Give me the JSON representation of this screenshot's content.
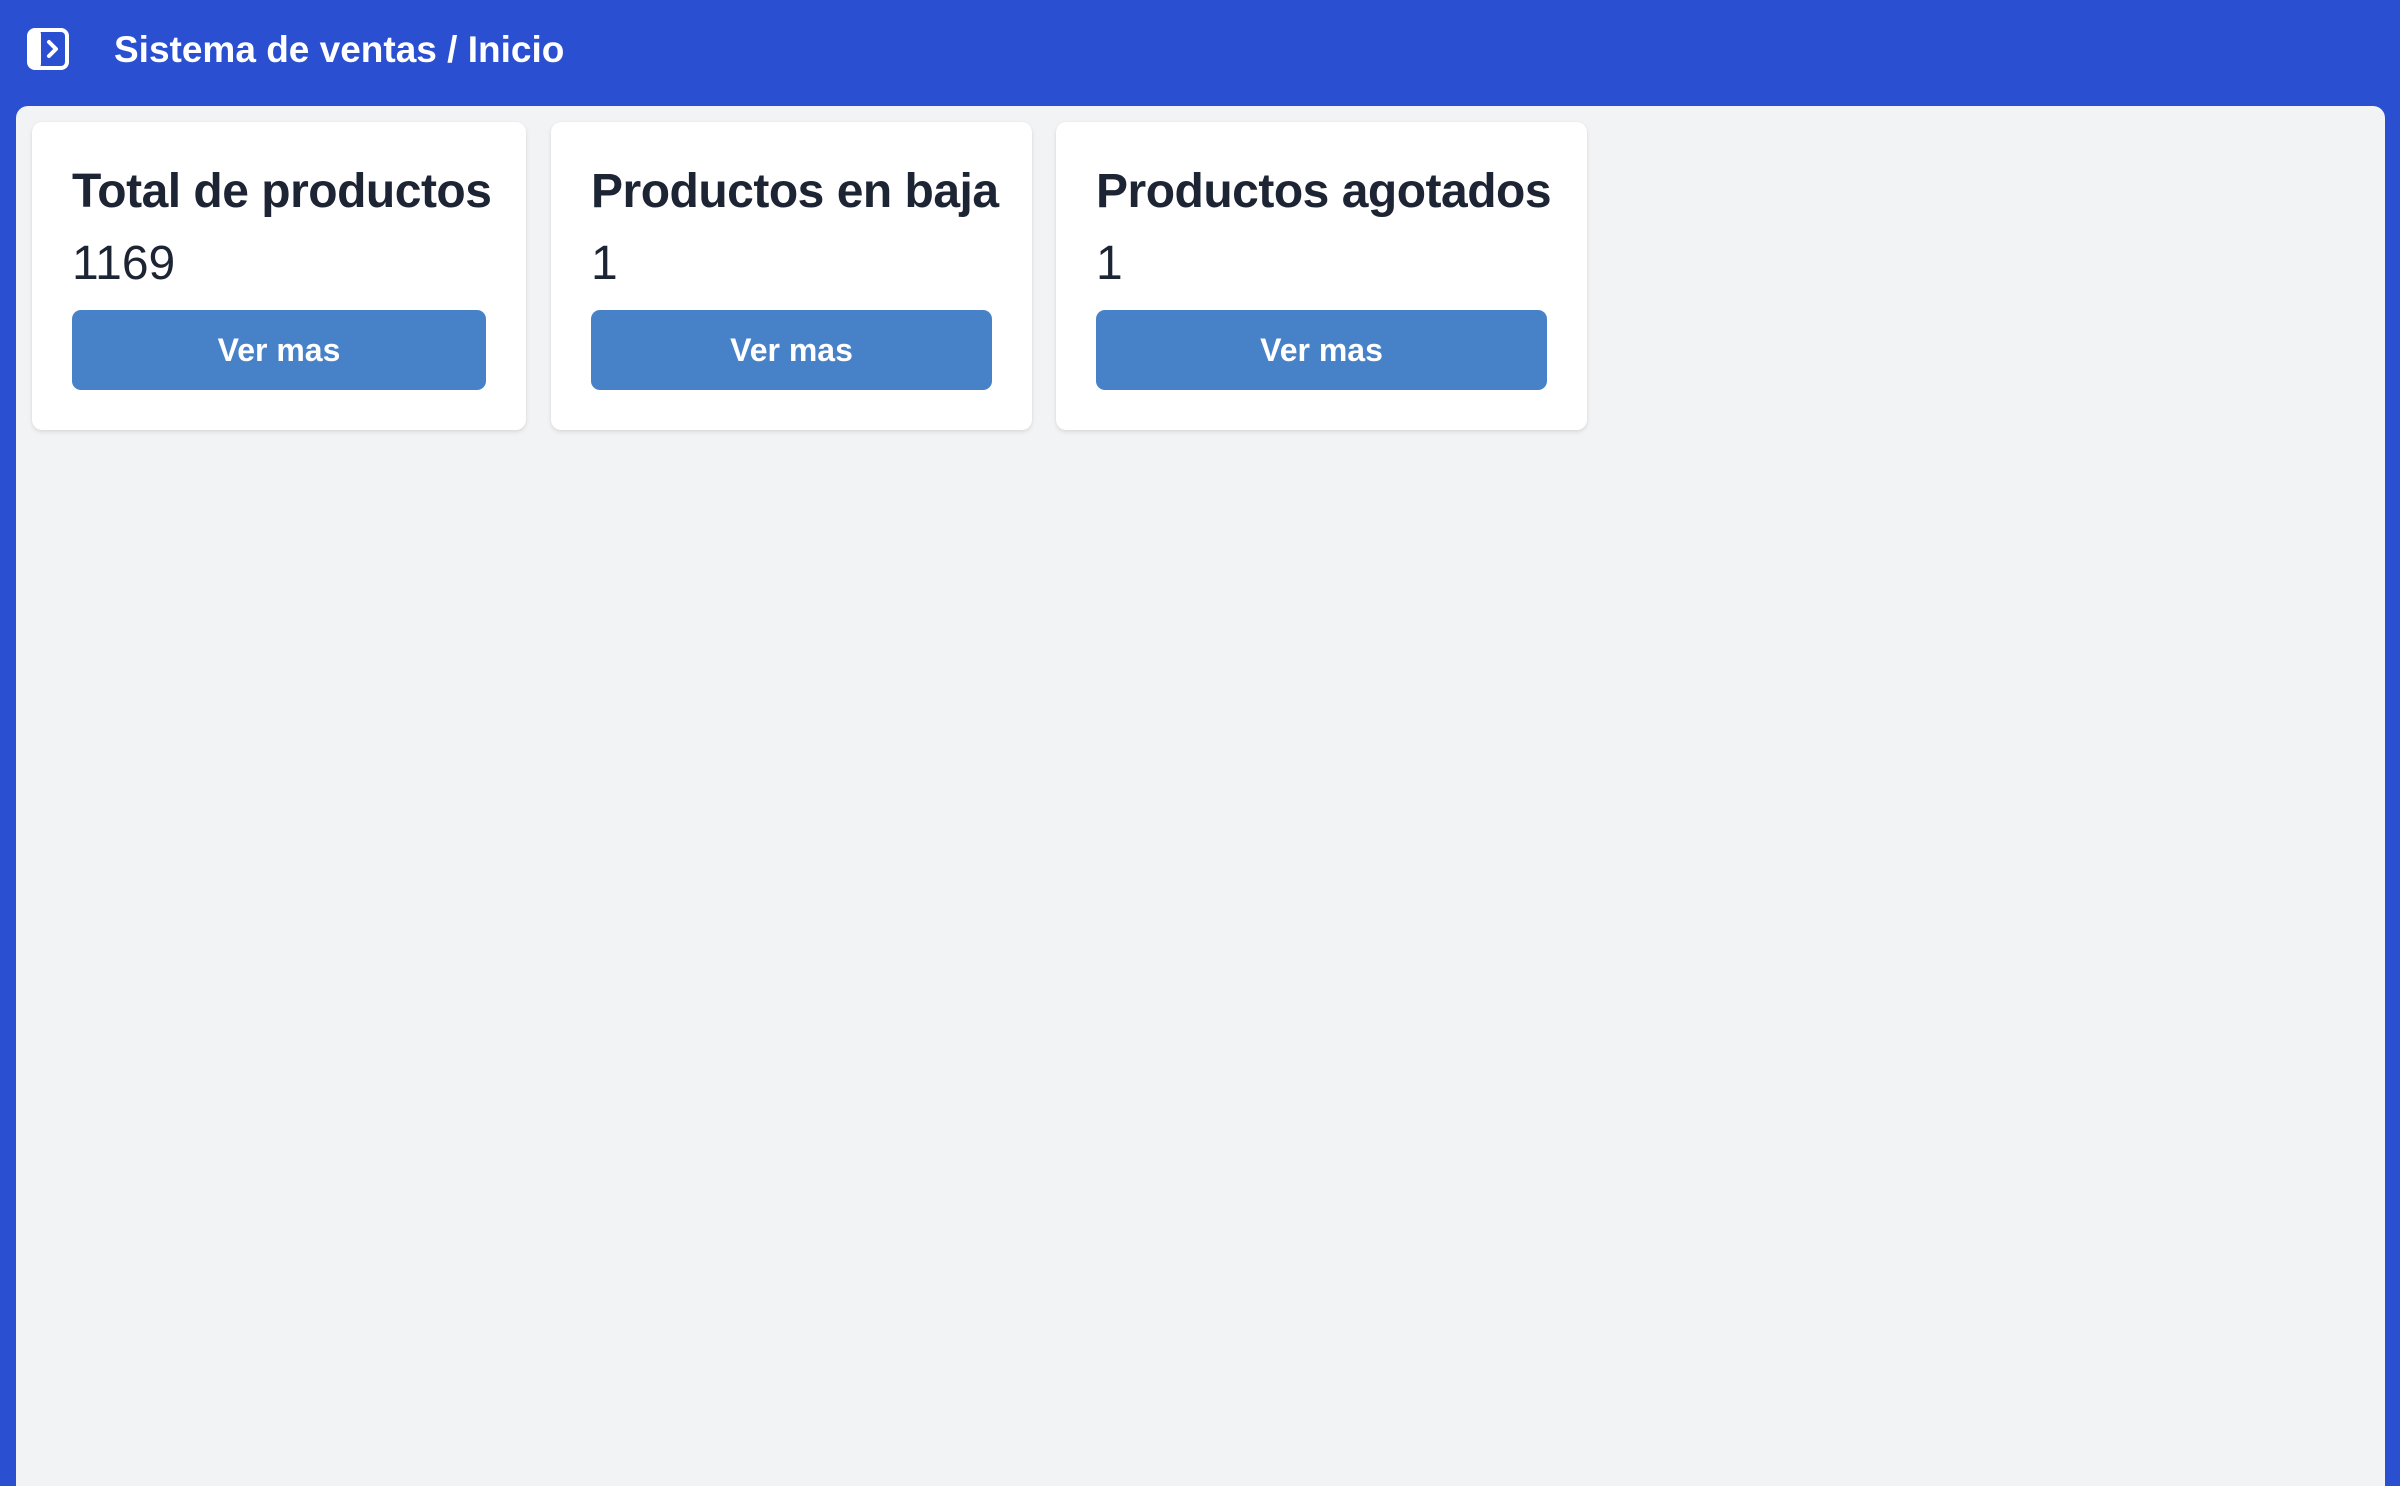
{
  "header": {
    "toggle_icon": "sidebar-expand-icon",
    "title": "Sistema de ventas / Inicio",
    "background_color": "#2b4fd1"
  },
  "main": {
    "background_color": "#f2f3f5",
    "cards": [
      {
        "title": "Total de productos",
        "value": "1169",
        "button_label": "Ver mas"
      },
      {
        "title": "Productos en baja",
        "value": "1",
        "button_label": "Ver mas"
      },
      {
        "title": "Productos agotados",
        "value": "1",
        "button_label": "Ver mas"
      }
    ],
    "button_color": "#4782c9"
  }
}
